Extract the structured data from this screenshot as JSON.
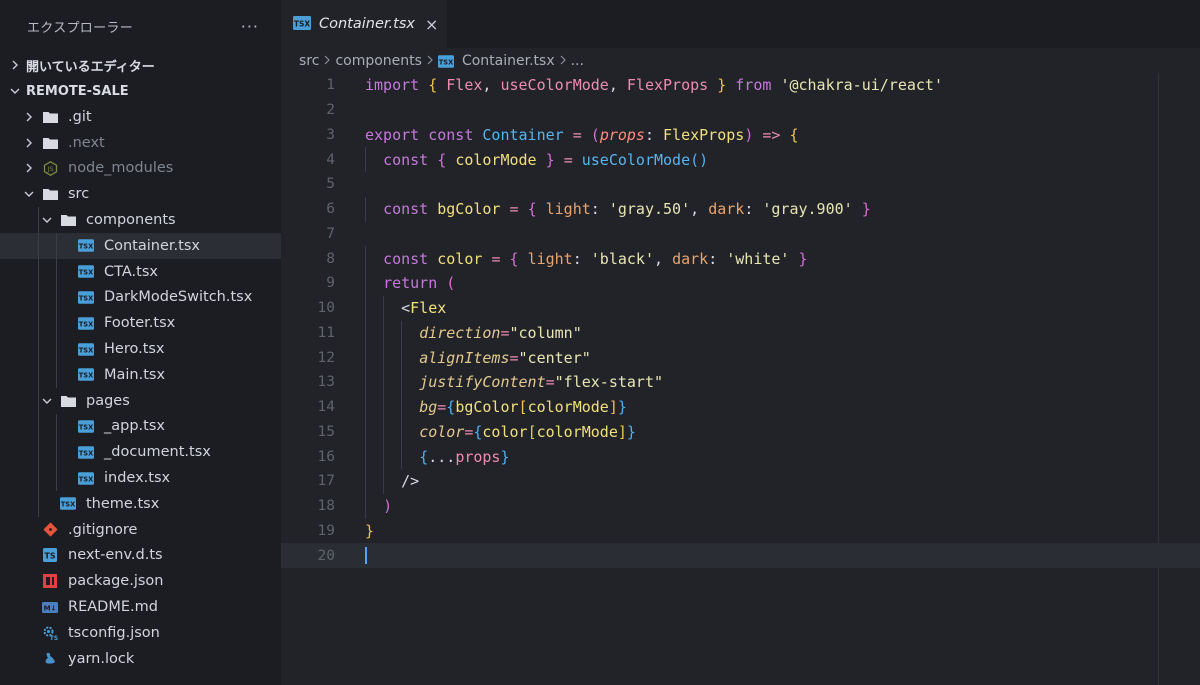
{
  "sidebar": {
    "title": "エクスプローラー",
    "more": "···",
    "open_editors": "開いているエディター",
    "project": "REMOTE-SALE",
    "items": [
      {
        "label": ".git",
        "icon": "folder-icon",
        "depth": 1,
        "chevron": "right",
        "dim": false
      },
      {
        "label": ".next",
        "icon": "folder-icon",
        "depth": 1,
        "chevron": "right",
        "dim": true
      },
      {
        "label": "node_modules",
        "icon": "nodejs-folder-icon",
        "depth": 1,
        "chevron": "right",
        "dim": true
      },
      {
        "label": "src",
        "icon": "folder-icon",
        "depth": 1,
        "chevron": "down",
        "dim": false
      },
      {
        "label": "components",
        "icon": "folder-icon",
        "depth": 2,
        "chevron": "down",
        "dim": false
      },
      {
        "label": "Container.tsx",
        "icon": "tsx-icon",
        "depth": 3,
        "active": true
      },
      {
        "label": "CTA.tsx",
        "icon": "tsx-icon",
        "depth": 3
      },
      {
        "label": "DarkModeSwitch.tsx",
        "icon": "tsx-icon",
        "depth": 3
      },
      {
        "label": "Footer.tsx",
        "icon": "tsx-icon",
        "depth": 3
      },
      {
        "label": "Hero.tsx",
        "icon": "tsx-icon",
        "depth": 3
      },
      {
        "label": "Main.tsx",
        "icon": "tsx-icon",
        "depth": 3
      },
      {
        "label": "pages",
        "icon": "folder-icon",
        "depth": 2,
        "chevron": "down",
        "dim": false
      },
      {
        "label": "_app.tsx",
        "icon": "tsx-icon",
        "depth": 3
      },
      {
        "label": "_document.tsx",
        "icon": "tsx-icon",
        "depth": 3
      },
      {
        "label": "index.tsx",
        "icon": "tsx-icon",
        "depth": 3
      },
      {
        "label": "theme.tsx",
        "icon": "tsx-icon",
        "depth": 2
      },
      {
        "label": ".gitignore",
        "icon": "git-icon",
        "depth": 1
      },
      {
        "label": "next-env.d.ts",
        "icon": "ts-icon",
        "depth": 1
      },
      {
        "label": "package.json",
        "icon": "npm-icon",
        "depth": 1
      },
      {
        "label": "README.md",
        "icon": "markdown-icon",
        "depth": 1
      },
      {
        "label": "tsconfig.json",
        "icon": "tsconfig-icon",
        "depth": 1
      },
      {
        "label": "yarn.lock",
        "icon": "yarn-icon",
        "depth": 1
      }
    ]
  },
  "tab": {
    "label": "Container.tsx",
    "close": "×"
  },
  "breadcrumb": {
    "src": "src",
    "components": "components",
    "file": "Container.tsx",
    "more": "..."
  },
  "colors": {
    "accent_cursor": "#5aa0ff",
    "tsx_icon": "#4a9fd8",
    "git_icon": "#e8543b",
    "npm_icon": "#e34141"
  },
  "code": {
    "line_numbers": [
      "1",
      "2",
      "3",
      "4",
      "5",
      "6",
      "7",
      "8",
      "9",
      "10",
      "11",
      "12",
      "13",
      "14",
      "15",
      "16",
      "17",
      "18",
      "19",
      "20"
    ],
    "lines": [
      [
        [
          "kw",
          "import"
        ],
        [
          "pl",
          " "
        ],
        [
          "br1",
          "{"
        ],
        [
          "pl",
          " "
        ],
        [
          "var",
          "Flex"
        ],
        [
          "pl",
          ", "
        ],
        [
          "var",
          "useColorMode"
        ],
        [
          "pl",
          ", "
        ],
        [
          "var",
          "FlexProps"
        ],
        [
          "pl",
          " "
        ],
        [
          "br1",
          "}"
        ],
        [
          "pl",
          " "
        ],
        [
          "kw",
          "from"
        ],
        [
          "pl",
          " "
        ],
        [
          "str",
          "'@chakra-ui/react'"
        ]
      ],
      [],
      [
        [
          "kw",
          "export"
        ],
        [
          "pl",
          " "
        ],
        [
          "kw",
          "const"
        ],
        [
          "pl",
          " "
        ],
        [
          "fn",
          "Container"
        ],
        [
          "pl",
          " "
        ],
        [
          "op",
          "="
        ],
        [
          "pl",
          " "
        ],
        [
          "br2",
          "("
        ],
        [
          "param",
          "props"
        ],
        [
          "pl",
          ": "
        ],
        [
          "ty",
          "FlexProps"
        ],
        [
          "br2",
          ")"
        ],
        [
          "pl",
          " "
        ],
        [
          "op",
          "=>"
        ],
        [
          "pl",
          " "
        ],
        [
          "br1",
          "{"
        ]
      ],
      [
        [
          "pl",
          "  "
        ],
        [
          "kw",
          "const"
        ],
        [
          "pl",
          " "
        ],
        [
          "br2",
          "{"
        ],
        [
          "pl",
          " "
        ],
        [
          "ty",
          "colorMode"
        ],
        [
          "pl",
          " "
        ],
        [
          "br2",
          "}"
        ],
        [
          "pl",
          " "
        ],
        [
          "op",
          "="
        ],
        [
          "pl",
          " "
        ],
        [
          "fn",
          "useColorMode"
        ],
        [
          "br3",
          "()"
        ]
      ],
      [],
      [
        [
          "pl",
          "  "
        ],
        [
          "kw",
          "const"
        ],
        [
          "pl",
          " "
        ],
        [
          "ty",
          "bgColor"
        ],
        [
          "pl",
          " "
        ],
        [
          "op",
          "="
        ],
        [
          "pl",
          " "
        ],
        [
          "br2",
          "{"
        ],
        [
          "pl",
          " "
        ],
        [
          "key",
          "light"
        ],
        [
          "pl",
          ": "
        ],
        [
          "str",
          "'gray.50'"
        ],
        [
          "pl",
          ", "
        ],
        [
          "key",
          "dark"
        ],
        [
          "pl",
          ": "
        ],
        [
          "str",
          "'gray.900'"
        ],
        [
          "pl",
          " "
        ],
        [
          "br2",
          "}"
        ]
      ],
      [],
      [
        [
          "pl",
          "  "
        ],
        [
          "kw",
          "const"
        ],
        [
          "pl",
          " "
        ],
        [
          "ty",
          "color"
        ],
        [
          "pl",
          " "
        ],
        [
          "op",
          "="
        ],
        [
          "pl",
          " "
        ],
        [
          "br2",
          "{"
        ],
        [
          "pl",
          " "
        ],
        [
          "key",
          "light"
        ],
        [
          "pl",
          ": "
        ],
        [
          "str",
          "'black'"
        ],
        [
          "pl",
          ", "
        ],
        [
          "key",
          "dark"
        ],
        [
          "pl",
          ": "
        ],
        [
          "str",
          "'white'"
        ],
        [
          "pl",
          " "
        ],
        [
          "br2",
          "}"
        ]
      ],
      [
        [
          "pl",
          "  "
        ],
        [
          "kw",
          "return"
        ],
        [
          "pl",
          " "
        ],
        [
          "br2",
          "("
        ]
      ],
      [
        [
          "pl",
          "    "
        ],
        [
          "pl",
          "<"
        ],
        [
          "tag",
          "Flex"
        ]
      ],
      [
        [
          "pl",
          "      "
        ],
        [
          "prop",
          "direction"
        ],
        [
          "op",
          "="
        ],
        [
          "str",
          "\"column\""
        ]
      ],
      [
        [
          "pl",
          "      "
        ],
        [
          "prop",
          "alignItems"
        ],
        [
          "op",
          "="
        ],
        [
          "str",
          "\"center\""
        ]
      ],
      [
        [
          "pl",
          "      "
        ],
        [
          "prop",
          "justifyContent"
        ],
        [
          "op",
          "="
        ],
        [
          "str",
          "\"flex-start\""
        ]
      ],
      [
        [
          "pl",
          "      "
        ],
        [
          "prop",
          "bg"
        ],
        [
          "op",
          "="
        ],
        [
          "br3",
          "{"
        ],
        [
          "ty",
          "bgColor"
        ],
        [
          "br1",
          "["
        ],
        [
          "ty",
          "colorMode"
        ],
        [
          "br1",
          "]"
        ],
        [
          "br3",
          "}"
        ]
      ],
      [
        [
          "pl",
          "      "
        ],
        [
          "prop",
          "color"
        ],
        [
          "op",
          "="
        ],
        [
          "br3",
          "{"
        ],
        [
          "ty",
          "color"
        ],
        [
          "br1",
          "["
        ],
        [
          "ty",
          "colorMode"
        ],
        [
          "br1",
          "]"
        ],
        [
          "br3",
          "}"
        ]
      ],
      [
        [
          "pl",
          "      "
        ],
        [
          "br3",
          "{"
        ],
        [
          "pl",
          "..."
        ],
        [
          "var",
          "props"
        ],
        [
          "br3",
          "}"
        ]
      ],
      [
        [
          "pl",
          "    "
        ],
        [
          "pl",
          "/>"
        ]
      ],
      [
        [
          "pl",
          "  "
        ],
        [
          "br2",
          ")"
        ]
      ],
      [
        [
          "br1",
          "}"
        ]
      ],
      []
    ]
  }
}
